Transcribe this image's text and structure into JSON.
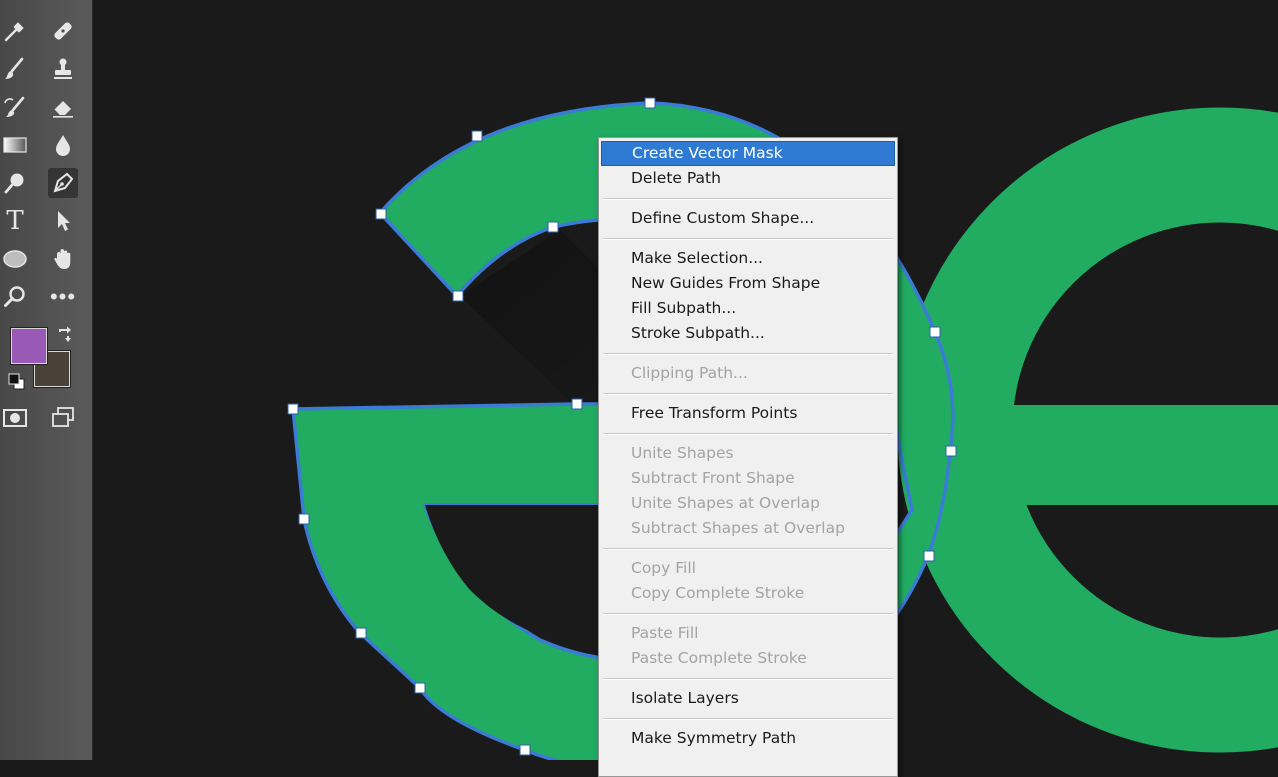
{
  "colors": {
    "foreground": "#9b59b6",
    "background": "#4a4236",
    "shape_fill": "#21ac62",
    "path_stroke": "#3a7bd5",
    "menu_highlight": "#2f7bd3"
  },
  "toolbar": {
    "tools": [
      {
        "name": "eyedropper-icon"
      },
      {
        "name": "healing-brush-icon"
      },
      {
        "name": "brush-icon"
      },
      {
        "name": "clone-stamp-icon"
      },
      {
        "name": "history-brush-icon"
      },
      {
        "name": "eraser-icon"
      },
      {
        "name": "gradient-icon"
      },
      {
        "name": "blur-icon"
      },
      {
        "name": "dodge-icon"
      },
      {
        "name": "pen-icon"
      },
      {
        "name": "type-icon",
        "glyph": "T"
      },
      {
        "name": "path-selection-icon"
      },
      {
        "name": "ellipse-icon"
      },
      {
        "name": "hand-icon"
      },
      {
        "name": "zoom-icon"
      },
      {
        "name": "more-tools-icon",
        "glyph": "•••"
      },
      {
        "name": "quick-mask-icon"
      },
      {
        "name": "screen-mode-icon"
      }
    ],
    "active_tool": "pen-icon"
  },
  "context_menu": {
    "items": [
      {
        "label": "Create Vector Mask",
        "state": "highlighted"
      },
      {
        "label": "Delete Path",
        "state": "enabled"
      },
      {
        "separator": true
      },
      {
        "label": "Define Custom Shape...",
        "state": "enabled"
      },
      {
        "separator": true
      },
      {
        "label": "Make Selection...",
        "state": "enabled"
      },
      {
        "label": "New Guides From Shape",
        "state": "enabled"
      },
      {
        "label": "Fill Subpath...",
        "state": "enabled"
      },
      {
        "label": "Stroke Subpath...",
        "state": "enabled"
      },
      {
        "separator": true
      },
      {
        "label": "Clipping Path...",
        "state": "disabled"
      },
      {
        "separator": true
      },
      {
        "label": "Free Transform Points",
        "state": "enabled"
      },
      {
        "separator": true
      },
      {
        "label": "Unite Shapes",
        "state": "disabled"
      },
      {
        "label": "Subtract Front Shape",
        "state": "disabled"
      },
      {
        "label": "Unite Shapes at Overlap",
        "state": "disabled"
      },
      {
        "label": "Subtract Shapes at Overlap",
        "state": "disabled"
      },
      {
        "separator": true
      },
      {
        "label": "Copy Fill",
        "state": "disabled"
      },
      {
        "label": "Copy Complete Stroke",
        "state": "disabled"
      },
      {
        "separator": true
      },
      {
        "label": "Paste Fill",
        "state": "disabled"
      },
      {
        "label": "Paste Complete Stroke",
        "state": "disabled"
      },
      {
        "separator": true
      },
      {
        "label": "Isolate Layers",
        "state": "enabled"
      },
      {
        "separator": true
      },
      {
        "label": "Make Symmetry Path",
        "state": "enabled"
      }
    ]
  }
}
